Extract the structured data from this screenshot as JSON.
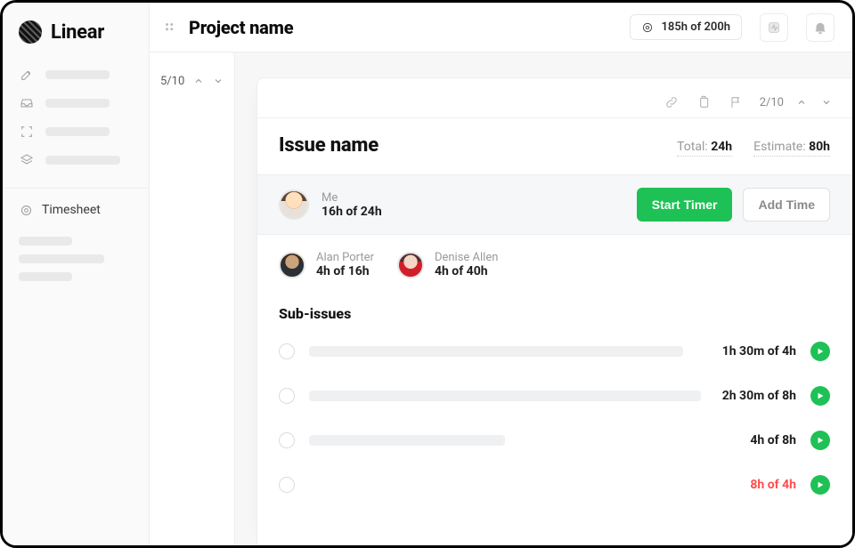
{
  "app": {
    "name": "Linear"
  },
  "sidebar": {
    "timesheet_label": "Timesheet"
  },
  "header": {
    "project_title": "Project name",
    "budget_pill": "185h of 200h"
  },
  "left_pager": {
    "label": "5/10"
  },
  "card": {
    "pager": "2/10",
    "issue_title": "Issue name",
    "total_label": "Total:",
    "total_value": "24h",
    "estimate_label": "Estimate:",
    "estimate_value": "80h",
    "me": {
      "name": "Me",
      "time": "16h of 24h",
      "start_timer_label": "Start Timer",
      "add_time_label": "Add Time"
    },
    "contributors": [
      {
        "name": "Alan Porter",
        "time": "4h of 16h"
      },
      {
        "name": "Denise Allen",
        "time": "4h of 40h"
      }
    ],
    "sub_section_title": "Sub-issues",
    "sub_issues": [
      {
        "time": "1h 30m of 4h",
        "over": false
      },
      {
        "time": "2h 30m of 8h",
        "over": false
      },
      {
        "time": "4h of 8h",
        "over": false
      },
      {
        "time": "8h of 4h",
        "over": true
      }
    ]
  }
}
